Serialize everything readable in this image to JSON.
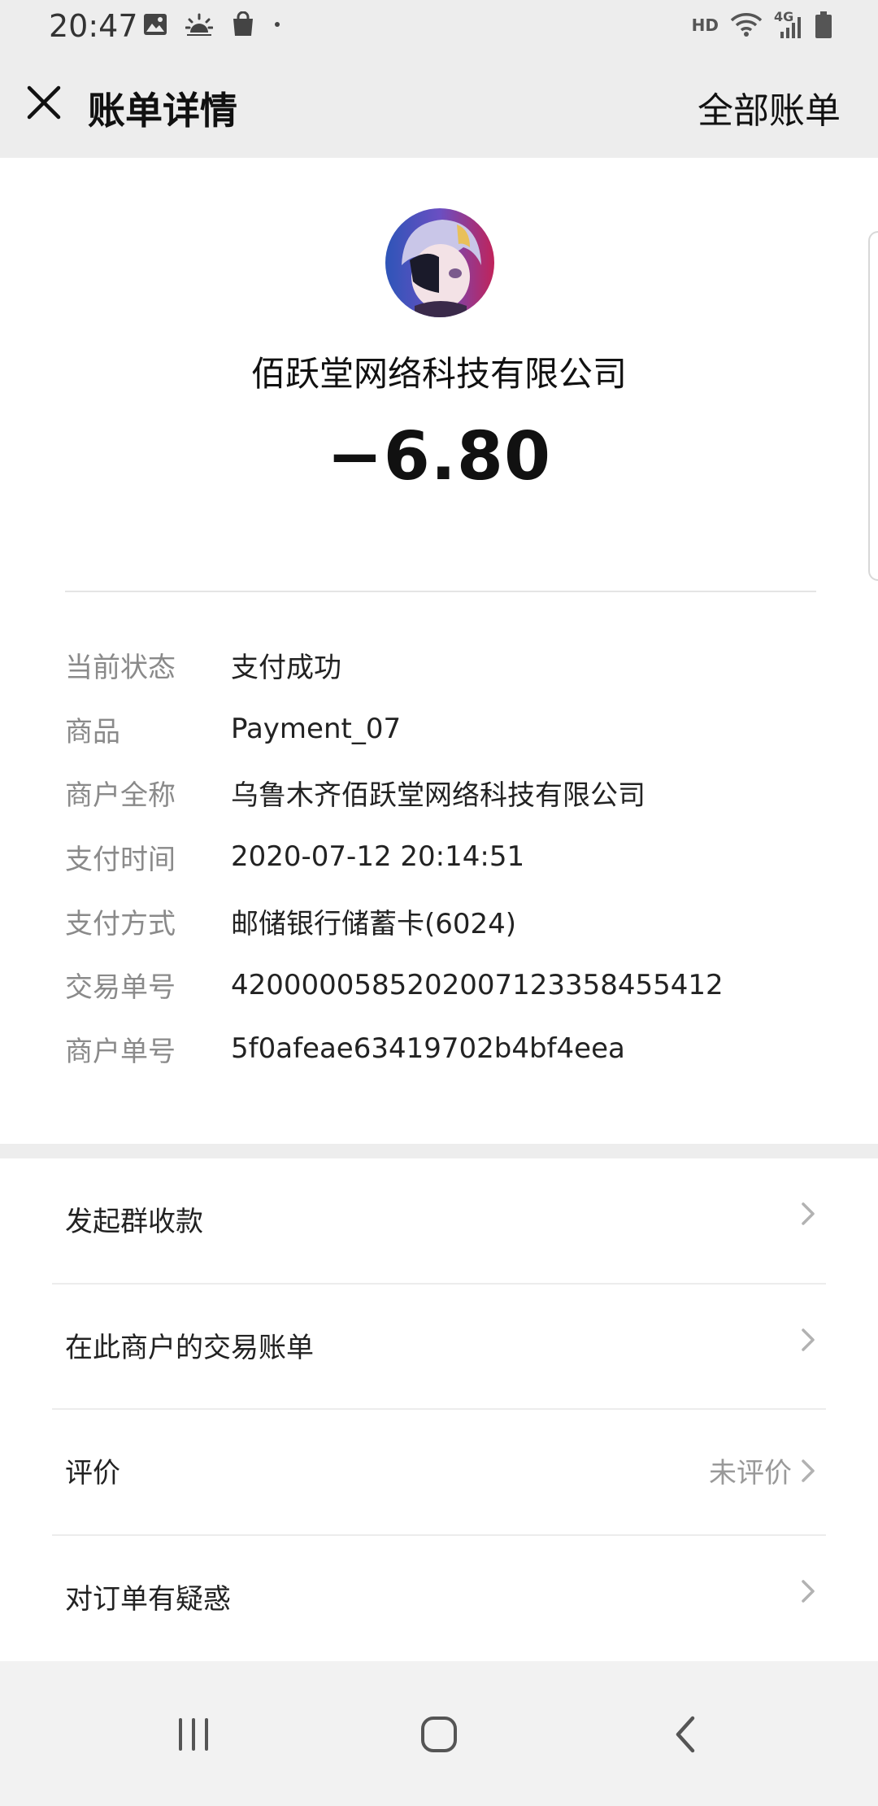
{
  "status_bar": {
    "time": "20:47",
    "hd": "HD",
    "network": "4G",
    "icons": [
      "image-icon",
      "weather-icon",
      "shopping-bag-icon",
      "dot-icon",
      "wifi-icon",
      "signal-icon",
      "battery-icon"
    ]
  },
  "nav": {
    "title": "账单详情",
    "right_link": "全部账单"
  },
  "bill": {
    "merchant_name": "佰跃堂网络科技有限公司",
    "amount": "−6.80",
    "details": [
      {
        "label": "当前状态",
        "value": "支付成功"
      },
      {
        "label": "商品",
        "value": "Payment_07"
      },
      {
        "label": "商户全称",
        "value": "乌鲁木齐佰跃堂网络科技有限公司"
      },
      {
        "label": "支付时间",
        "value": "2020-07-12 20:14:51"
      },
      {
        "label": "支付方式",
        "value": "邮储银行储蓄卡(6024)"
      },
      {
        "label": "交易单号",
        "value": "4200000585202007123358455412"
      },
      {
        "label": "商户单号",
        "value": "5f0afeae63419702b4bf4eea"
      }
    ]
  },
  "menu": {
    "items": [
      {
        "label": "发起群收款",
        "aside": ""
      },
      {
        "label": "在此商户的交易账单",
        "aside": ""
      },
      {
        "label": "评价",
        "aside": "未评价"
      },
      {
        "label": "对订单有疑惑",
        "aside": ""
      }
    ]
  },
  "colors": {
    "page_bg": "#ededed",
    "card_bg": "#ffffff",
    "label_gray": "#8a8a8a",
    "text": "#111111"
  }
}
